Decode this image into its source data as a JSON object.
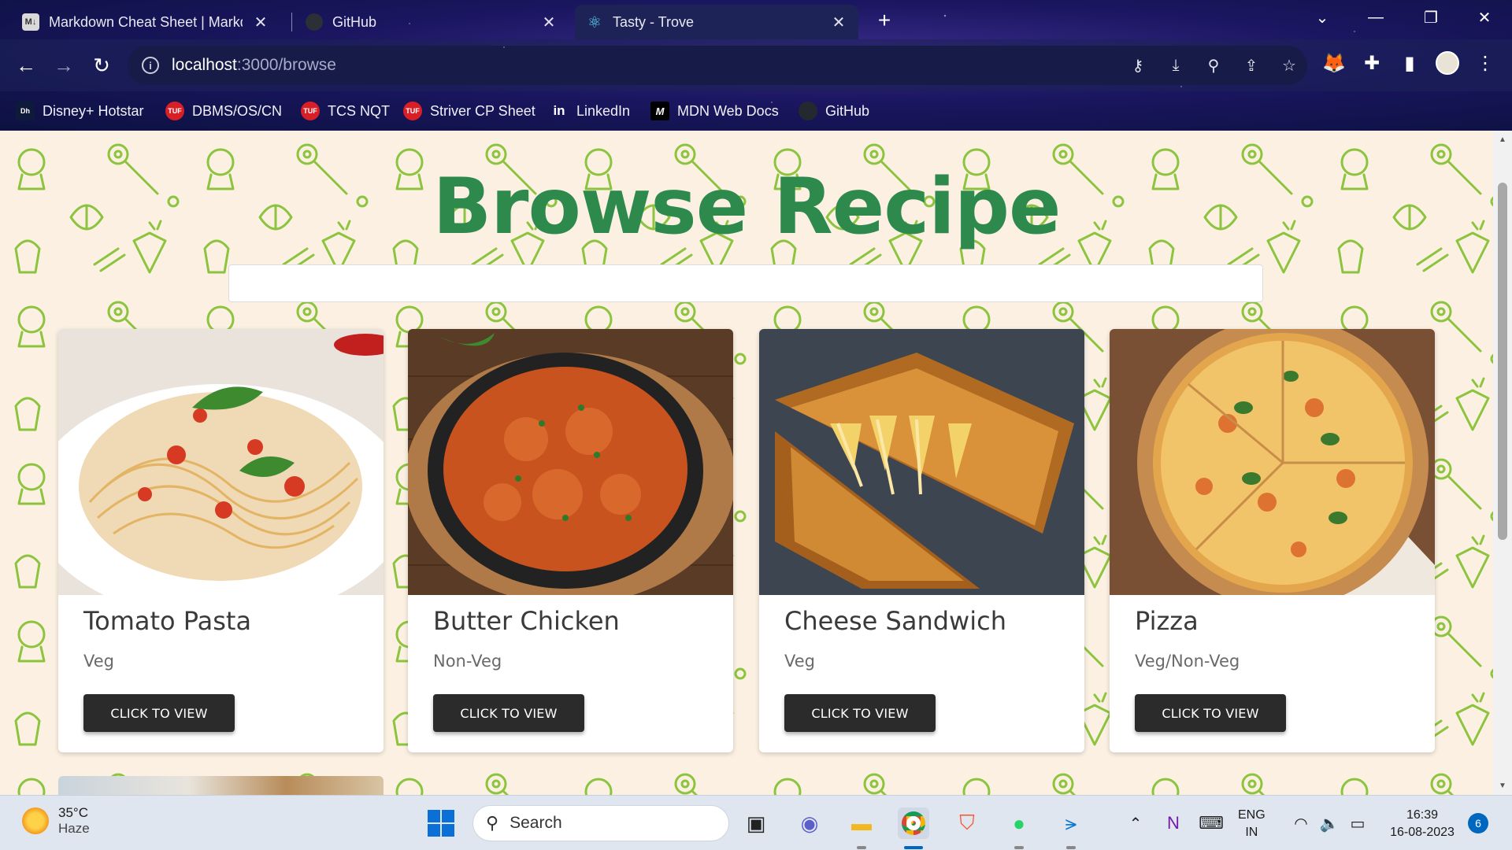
{
  "browser": {
    "tabs": [
      {
        "title": "Markdown Cheat Sheet | Markdo",
        "favicon": "M↓",
        "active": false
      },
      {
        "title": "GitHub",
        "favicon": "github-icon",
        "active": false
      },
      {
        "title": "Tasty - Trove",
        "favicon": "react-icon",
        "active": true
      }
    ],
    "url_host": "localhost",
    "url_rest": ":3000/browse",
    "bookmarks": [
      {
        "label": "Disney+ Hotstar",
        "icon": "hotstar-icon",
        "color": "#0d1a3a",
        "badge": "Dh"
      },
      {
        "label": "DBMS/OS/CN",
        "icon": "tuf-icon",
        "color": "#d81f26",
        "badge": "TUF"
      },
      {
        "label": "TCS NQT",
        "icon": "tuf-icon",
        "color": "#d81f26",
        "badge": "TUF"
      },
      {
        "label": "Striver CP Sheet",
        "icon": "tuf-icon",
        "color": "#d81f26",
        "badge": "TUF"
      },
      {
        "label": "LinkedIn",
        "icon": "linkedin-icon",
        "color": "#0a66c2",
        "badge": "in"
      },
      {
        "label": "MDN Web Docs",
        "icon": "mdn-icon",
        "color": "#000000",
        "badge": "M"
      },
      {
        "label": "GitHub",
        "icon": "github-icon",
        "color": "#24292f",
        "badge": ""
      }
    ]
  },
  "page": {
    "title": "Browse Recipe",
    "search_value": "",
    "accent": "#2d8a4c",
    "recipes": [
      {
        "name": "Tomato Pasta",
        "type": "Veg",
        "button": "CLICK TO VIEW"
      },
      {
        "name": "Butter Chicken",
        "type": "Non-Veg",
        "button": "CLICK TO VIEW"
      },
      {
        "name": "Cheese Sandwich",
        "type": "Veg",
        "button": "CLICK TO VIEW"
      },
      {
        "name": "Pizza",
        "type": "Veg/Non-Veg",
        "button": "CLICK TO VIEW"
      }
    ]
  },
  "taskbar": {
    "temperature": "35°C",
    "weather": "Haze",
    "search_label": "Search",
    "lang_top": "ENG",
    "lang_bottom": "IN",
    "time": "16:39",
    "date": "16-08-2023",
    "notifications": "6"
  }
}
